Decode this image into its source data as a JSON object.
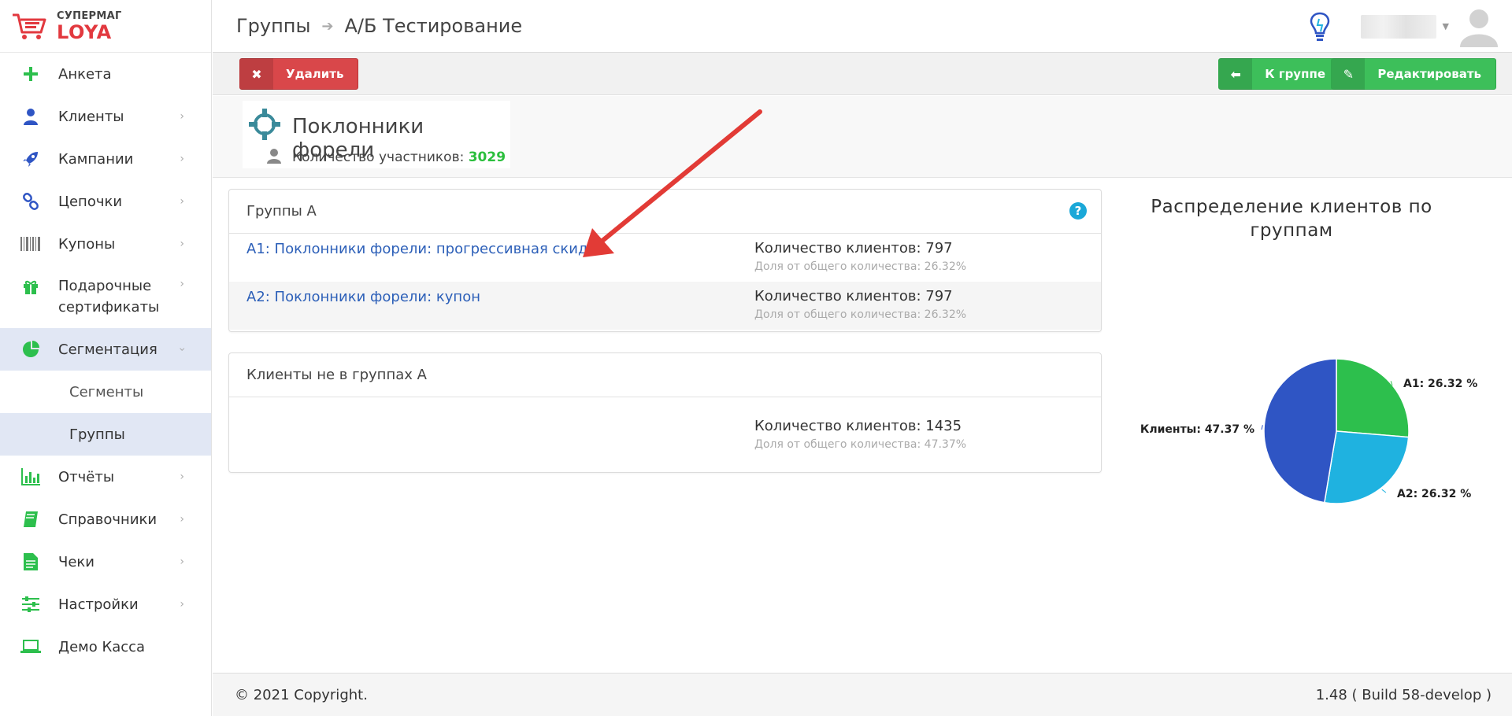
{
  "logo": {
    "line1": "СУПЕРМАГ",
    "line2": "LOYA"
  },
  "sidebar": {
    "items": [
      {
        "label": "Анкета",
        "icon": "plus-icon",
        "chevron": false
      },
      {
        "label": "Клиенты",
        "icon": "user-icon",
        "chevron": true
      },
      {
        "label": "Кампании",
        "icon": "rocket-icon",
        "chevron": true
      },
      {
        "label": "Цепочки",
        "icon": "link-icon",
        "chevron": true
      },
      {
        "label": "Купоны",
        "icon": "barcode-icon",
        "chevron": true
      },
      {
        "label": "Подарочные сертификаты",
        "icon": "gift-icon",
        "chevron": true
      },
      {
        "label": "Сегментация",
        "icon": "pie-chart-icon",
        "chevron": true,
        "expanded": true
      },
      {
        "label": "Отчёты",
        "icon": "bar-chart-icon",
        "chevron": true
      },
      {
        "label": "Справочники",
        "icon": "book-icon",
        "chevron": true
      },
      {
        "label": "Чеки",
        "icon": "document-icon",
        "chevron": true
      },
      {
        "label": "Настройки",
        "icon": "sliders-icon",
        "chevron": true
      },
      {
        "label": "Демо Касса",
        "icon": "laptop-icon",
        "chevron": false
      }
    ],
    "sub_items": [
      {
        "label": "Сегменты"
      },
      {
        "label": "Группы",
        "active": true
      }
    ]
  },
  "header": {
    "breadcrumb": [
      "Группы",
      "А/Б Тестирование"
    ]
  },
  "toolbar": {
    "delete_label": "Удалить",
    "back_label": "К группе",
    "edit_label": "Редактировать"
  },
  "group": {
    "title": "Поклонники форели",
    "members_label": "Количество участников:",
    "members_count": "3029"
  },
  "panel_a": {
    "title": "Группы А",
    "rows": [
      {
        "link": "А1: Поклонники форели: прогрессивная скидка",
        "count": "Количество клиентов: 797",
        "share": "Доля от общего количества: 26.32%"
      },
      {
        "link": "А2: Поклонники форели: купон",
        "count": "Количество клиентов: 797",
        "share": "Доля от общего количества: 26.32%"
      }
    ]
  },
  "panel_rest": {
    "title": "Клиенты не в группах А",
    "count": "Количество клиентов: 1435",
    "share": "Доля от общего количества: 47.37%"
  },
  "chart_data": {
    "type": "pie",
    "title": "Распределение клиентов по группам",
    "slices": [
      {
        "label": "А1",
        "value": 26.32,
        "display": "А1: 26.32 %",
        "color": "#2dbf4d"
      },
      {
        "label": "А2",
        "value": 26.32,
        "display": "А2: 26.32 %",
        "color": "#1fb2e0"
      },
      {
        "label": "Клиенты",
        "value": 47.37,
        "display": "Клиенты: 47.37 %",
        "color": "#2f55c4"
      }
    ]
  },
  "footer": {
    "copyright": "© 2021 Copyright.",
    "version": "1.48 ( Build 58-develop )"
  },
  "colors": {
    "brand_red": "#e2393f",
    "green": "#3dbf5a",
    "link": "#2c5fb8",
    "active_bg": "#e1e7f4"
  }
}
